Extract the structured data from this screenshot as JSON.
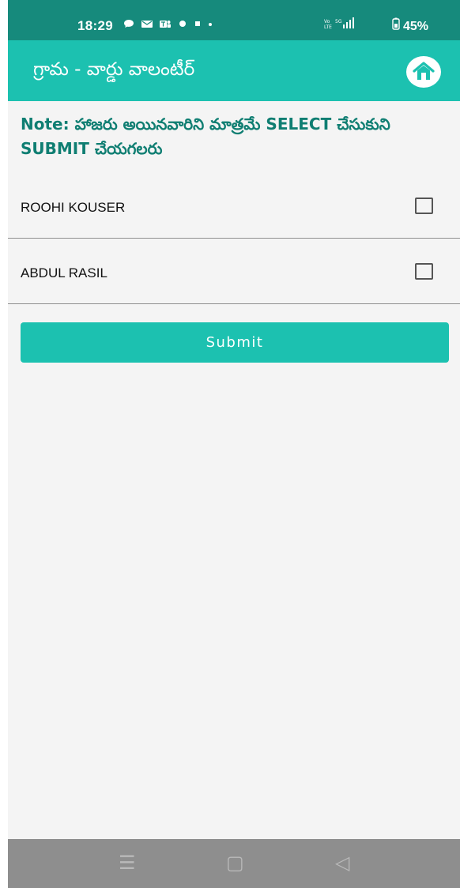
{
  "status_bar": {
    "time": "18:29",
    "notification_icons": [
      "chat-icon",
      "message-icon",
      "teams-icon",
      "dot-icon",
      "sim-icon",
      "dot-icon"
    ],
    "network": "Vo LTE 5G",
    "battery": "45%"
  },
  "app_bar": {
    "title": "గ్రామ - వార్డు వాలంటీర్",
    "home_icon": "home-icon"
  },
  "note": {
    "text": "Note: హాజరు అయినవారిని మాత్రమే SELECT చేసుకుని SUBMIT  చేయగలరు"
  },
  "attendees": [
    {
      "name": "ROOHI KOUSER",
      "checked": false
    },
    {
      "name": "ABDUL RASIL",
      "checked": false
    }
  ],
  "submit": {
    "label": "Submit"
  },
  "nav_bar": {
    "menu_icon": "☰",
    "home_icon": "▢",
    "back_icon": "◁"
  },
  "colors": {
    "status_bar": "#168a7c",
    "app_bar": "#1cc1b0",
    "note_text": "#0f7e72",
    "background": "#f4f4f4",
    "nav_bar": "#8e8e8e"
  }
}
